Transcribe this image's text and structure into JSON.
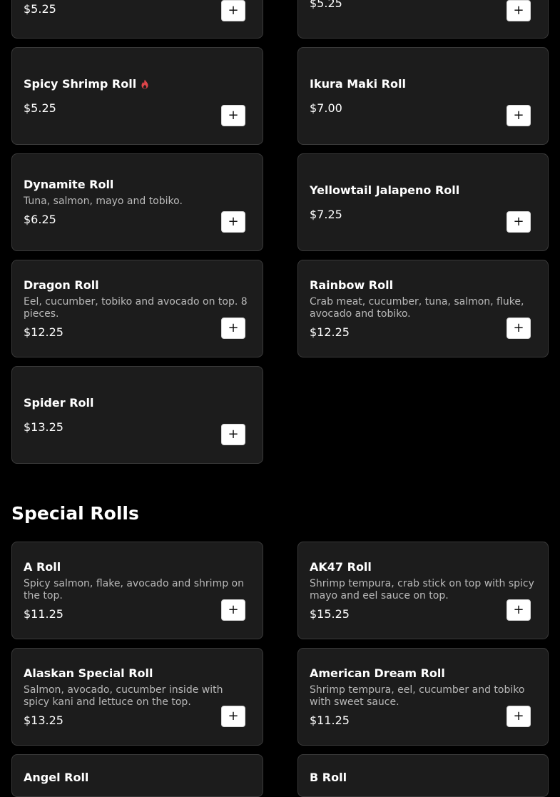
{
  "top_prices": {
    "left": "$5.25",
    "right": "$5.25"
  },
  "add_symbol": "+",
  "items": {
    "spicy_shrimp": {
      "name": "Spicy Shrimp Roll",
      "price": "$5.25"
    },
    "ikura": {
      "name": "Ikura Maki Roll",
      "price": "$7.00"
    },
    "dynamite": {
      "name": "Dynamite Roll",
      "desc": "Tuna, salmon, mayo and tobiko.",
      "price": "$6.25"
    },
    "yellowtail": {
      "name": "Yellowtail Jalapeno Roll",
      "price": "$7.25"
    },
    "dragon": {
      "name": "Dragon Roll",
      "desc": "Eel, cucumber, tobiko and avocado on top. 8 pieces.",
      "price": "$12.25"
    },
    "rainbow": {
      "name": "Rainbow Roll",
      "desc": "Crab meat, cucumber, tuna, salmon, fluke, avocado and tobiko.",
      "price": "$12.25"
    },
    "spider": {
      "name": "Spider Roll",
      "price": "$13.25"
    }
  },
  "special_section": {
    "title": "Special Rolls",
    "items": {
      "a_roll": {
        "name": "A Roll",
        "desc": "Spicy salmon, flake, avocado and shrimp on the top.",
        "price": "$11.25"
      },
      "ak47": {
        "name": "AK47 Roll",
        "desc": "Shrimp tempura, crab stick on top with spicy mayo and eel sauce on top.",
        "price": "$15.25"
      },
      "alaskan": {
        "name": "Alaskan Special Roll",
        "desc": "Salmon, avocado, cucumber inside with spicy kani and lettuce on the top.",
        "price": "$13.25"
      },
      "american_dream": {
        "name": "American Dream Roll",
        "desc": "Shrimp tempura, eel, cucumber and tobiko with sweet sauce.",
        "price": "$11.25"
      },
      "angel": {
        "name": "Angel Roll"
      },
      "b_roll": {
        "name": "B Roll"
      }
    }
  },
  "colors": {
    "background": "#000000",
    "card": "#1c1c1c",
    "card_border": "#3a3a3a",
    "spicy": "#e0454a"
  },
  "icons": {
    "spicy": "flame-icon",
    "add": "plus-icon"
  }
}
